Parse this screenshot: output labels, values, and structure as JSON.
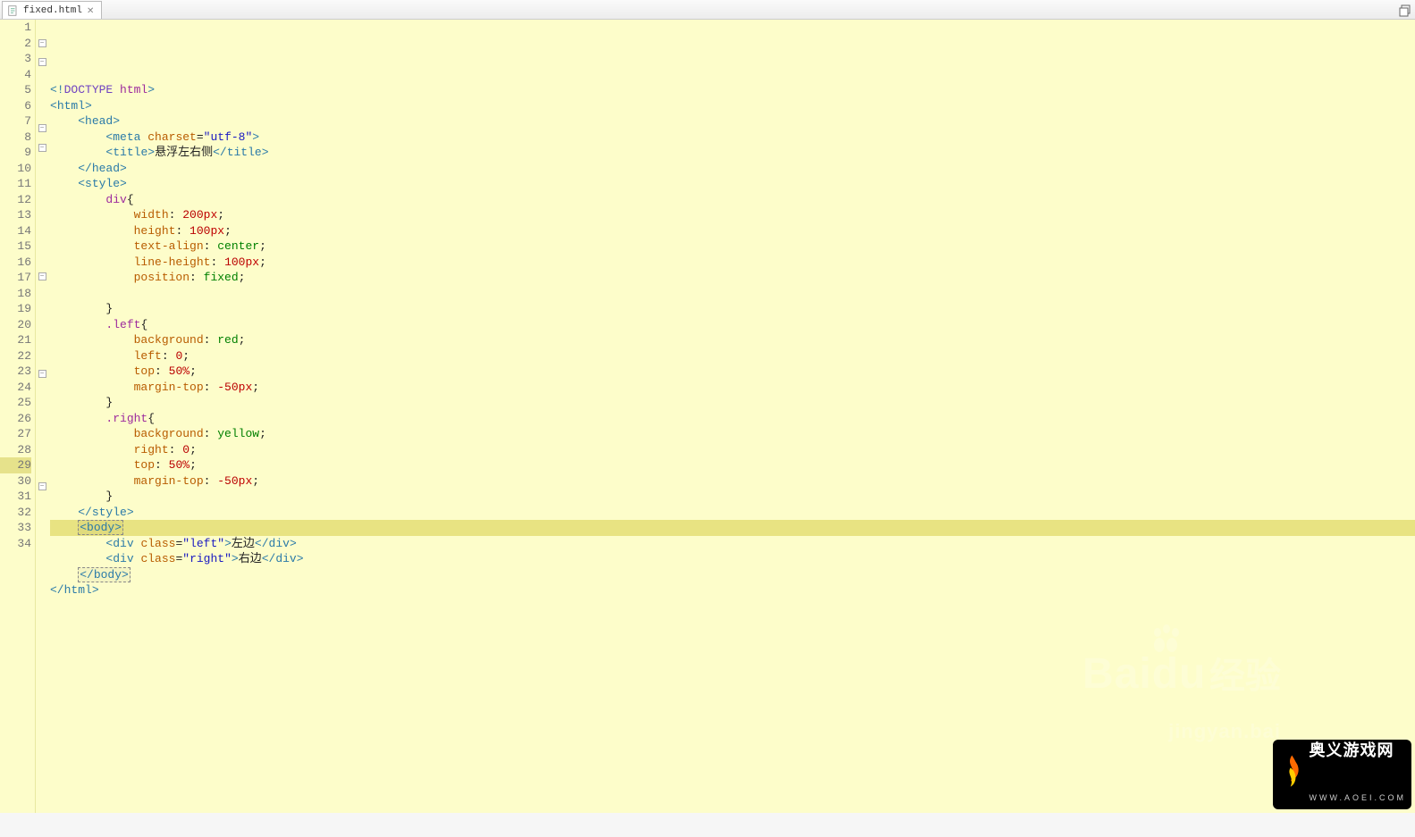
{
  "tab": {
    "filename": "fixed.html"
  },
  "gutter": {
    "lines": 34,
    "fold_lines": [
      2,
      3,
      7,
      8,
      16,
      22,
      29
    ]
  },
  "code_lines": [
    {
      "n": 1,
      "tokens": [
        [
          "<!",
          "tag"
        ],
        [
          "DOCTYPE ",
          "kw"
        ],
        [
          "html",
          "magenta"
        ],
        [
          ">",
          "tag"
        ]
      ]
    },
    {
      "n": 2,
      "fold": true,
      "tokens": [
        [
          "<",
          "tag"
        ],
        [
          "html",
          "tag"
        ],
        [
          ">",
          "tag"
        ]
      ]
    },
    {
      "n": 3,
      "fold": true,
      "tokens": [
        [
          "    ",
          "text"
        ],
        [
          "<",
          "tag"
        ],
        [
          "head",
          "tag"
        ],
        [
          ">",
          "tag"
        ]
      ]
    },
    {
      "n": 4,
      "tokens": [
        [
          "        ",
          "text"
        ],
        [
          "<",
          "tag"
        ],
        [
          "meta ",
          "tag"
        ],
        [
          "charset",
          "name"
        ],
        [
          "=",
          "text"
        ],
        [
          "\"utf-8\"",
          "str"
        ],
        [
          ">",
          "tag"
        ]
      ]
    },
    {
      "n": 5,
      "tokens": [
        [
          "        ",
          "text"
        ],
        [
          "<",
          "tag"
        ],
        [
          "title",
          "tag"
        ],
        [
          ">",
          "tag"
        ],
        [
          "悬浮左右侧",
          "text"
        ],
        [
          "</",
          "tag"
        ],
        [
          "title",
          "tag"
        ],
        [
          ">",
          "tag"
        ]
      ]
    },
    {
      "n": 6,
      "tokens": [
        [
          "    ",
          "text"
        ],
        [
          "</",
          "tag"
        ],
        [
          "head",
          "tag"
        ],
        [
          ">",
          "tag"
        ]
      ]
    },
    {
      "n": 7,
      "fold": true,
      "tokens": [
        [
          "    ",
          "text"
        ],
        [
          "<",
          "tag"
        ],
        [
          "style",
          "tag"
        ],
        [
          ">",
          "tag"
        ]
      ]
    },
    {
      "n": 8,
      "fold": true,
      "tokens": [
        [
          "        ",
          "text"
        ],
        [
          "div",
          "css-sel"
        ],
        [
          "{",
          "text"
        ]
      ]
    },
    {
      "n": 9,
      "tokens": [
        [
          "            ",
          "text"
        ],
        [
          "width",
          "cssprop"
        ],
        [
          ": ",
          "text"
        ],
        [
          "200",
          "cssnum"
        ],
        [
          "px",
          "red"
        ],
        [
          ";",
          "text"
        ]
      ]
    },
    {
      "n": 10,
      "tokens": [
        [
          "            ",
          "text"
        ],
        [
          "height",
          "cssprop"
        ],
        [
          ": ",
          "text"
        ],
        [
          "100",
          "cssnum"
        ],
        [
          "px",
          "red"
        ],
        [
          ";",
          "text"
        ]
      ]
    },
    {
      "n": 11,
      "tokens": [
        [
          "            ",
          "text"
        ],
        [
          "text-align",
          "cssprop"
        ],
        [
          ": ",
          "text"
        ],
        [
          "center",
          "cssval"
        ],
        [
          ";",
          "text"
        ]
      ]
    },
    {
      "n": 12,
      "tokens": [
        [
          "            ",
          "text"
        ],
        [
          "line-height",
          "cssprop"
        ],
        [
          ": ",
          "text"
        ],
        [
          "100",
          "cssnum"
        ],
        [
          "px",
          "red"
        ],
        [
          ";",
          "text"
        ]
      ]
    },
    {
      "n": 13,
      "tokens": [
        [
          "            ",
          "text"
        ],
        [
          "position",
          "cssprop"
        ],
        [
          ": ",
          "text"
        ],
        [
          "fixed",
          "cssval"
        ],
        [
          ";",
          "text"
        ]
      ]
    },
    {
      "n": 14,
      "tokens": [
        [
          "",
          "text"
        ]
      ]
    },
    {
      "n": 15,
      "tokens": [
        [
          "        ",
          "text"
        ],
        [
          "}",
          "text"
        ]
      ]
    },
    {
      "n": 16,
      "fold": true,
      "tokens": [
        [
          "        ",
          "text"
        ],
        [
          ".left",
          "css-sel"
        ],
        [
          "{",
          "text"
        ]
      ]
    },
    {
      "n": 17,
      "tokens": [
        [
          "            ",
          "text"
        ],
        [
          "background",
          "cssprop"
        ],
        [
          ": ",
          "text"
        ],
        [
          "red",
          "cssval"
        ],
        [
          ";",
          "text"
        ]
      ]
    },
    {
      "n": 18,
      "tokens": [
        [
          "            ",
          "text"
        ],
        [
          "left",
          "cssprop"
        ],
        [
          ": ",
          "text"
        ],
        [
          "0",
          "cssnum"
        ],
        [
          ";",
          "text"
        ]
      ]
    },
    {
      "n": 19,
      "tokens": [
        [
          "            ",
          "text"
        ],
        [
          "top",
          "cssprop"
        ],
        [
          ": ",
          "text"
        ],
        [
          "50",
          "cssnum"
        ],
        [
          "%",
          "red"
        ],
        [
          ";",
          "text"
        ]
      ]
    },
    {
      "n": 20,
      "tokens": [
        [
          "            ",
          "text"
        ],
        [
          "margin-top",
          "cssprop"
        ],
        [
          ": ",
          "text"
        ],
        [
          "-50",
          "cssnum"
        ],
        [
          "px",
          "red"
        ],
        [
          ";",
          "text"
        ]
      ]
    },
    {
      "n": 21,
      "tokens": [
        [
          "        ",
          "text"
        ],
        [
          "}",
          "text"
        ]
      ]
    },
    {
      "n": 22,
      "fold": true,
      "tokens": [
        [
          "        ",
          "text"
        ],
        [
          ".right",
          "css-sel"
        ],
        [
          "{",
          "text"
        ]
      ]
    },
    {
      "n": 23,
      "tokens": [
        [
          "            ",
          "text"
        ],
        [
          "background",
          "cssprop"
        ],
        [
          ": ",
          "text"
        ],
        [
          "yellow",
          "cssval"
        ],
        [
          ";",
          "text"
        ]
      ]
    },
    {
      "n": 24,
      "tokens": [
        [
          "            ",
          "text"
        ],
        [
          "right",
          "cssprop"
        ],
        [
          ": ",
          "text"
        ],
        [
          "0",
          "cssnum"
        ],
        [
          ";",
          "text"
        ]
      ]
    },
    {
      "n": 25,
      "tokens": [
        [
          "            ",
          "text"
        ],
        [
          "top",
          "cssprop"
        ],
        [
          ": ",
          "text"
        ],
        [
          "50",
          "cssnum"
        ],
        [
          "%",
          "red"
        ],
        [
          ";",
          "text"
        ]
      ]
    },
    {
      "n": 26,
      "tokens": [
        [
          "            ",
          "text"
        ],
        [
          "margin-top",
          "cssprop"
        ],
        [
          ": ",
          "text"
        ],
        [
          "-50",
          "cssnum"
        ],
        [
          "px",
          "red"
        ],
        [
          ";",
          "text"
        ]
      ]
    },
    {
      "n": 27,
      "tokens": [
        [
          "        ",
          "text"
        ],
        [
          "}",
          "text"
        ]
      ]
    },
    {
      "n": 28,
      "tokens": [
        [
          "    ",
          "text"
        ],
        [
          "</",
          "tag"
        ],
        [
          "style",
          "tag"
        ],
        [
          ">",
          "tag"
        ]
      ]
    },
    {
      "n": 29,
      "fold": true,
      "highlight": true,
      "tokens": [
        [
          "    ",
          "text"
        ],
        [
          "<body>",
          "boxtag"
        ]
      ]
    },
    {
      "n": 30,
      "tokens": [
        [
          "        ",
          "text"
        ],
        [
          "<",
          "tag"
        ],
        [
          "div ",
          "tag"
        ],
        [
          "class",
          "name"
        ],
        [
          "=",
          "text"
        ],
        [
          "\"left\"",
          "str"
        ],
        [
          ">",
          "tag"
        ],
        [
          "左边",
          "text"
        ],
        [
          "</",
          "tag"
        ],
        [
          "div",
          "tag"
        ],
        [
          ">",
          "tag"
        ]
      ]
    },
    {
      "n": 31,
      "tokens": [
        [
          "        ",
          "text"
        ],
        [
          "<",
          "tag"
        ],
        [
          "div ",
          "tag"
        ],
        [
          "class",
          "name"
        ],
        [
          "=",
          "text"
        ],
        [
          "\"right\"",
          "str"
        ],
        [
          ">",
          "tag"
        ],
        [
          "右边",
          "text"
        ],
        [
          "</",
          "tag"
        ],
        [
          "div",
          "tag"
        ],
        [
          ">",
          "tag"
        ]
      ]
    },
    {
      "n": 32,
      "tokens": [
        [
          "    ",
          "text"
        ],
        [
          "</body>",
          "boxtag"
        ]
      ]
    },
    {
      "n": 33,
      "tokens": [
        [
          "</",
          "tag"
        ],
        [
          "html",
          "tag"
        ],
        [
          ">",
          "tag"
        ]
      ]
    },
    {
      "n": 34,
      "tokens": [
        [
          "",
          "text"
        ]
      ]
    }
  ],
  "watermark": {
    "baidu_big": "Bai",
    "baidu_du": "du",
    "baidu_cn": "经验",
    "baidu_sub": "jingyan.bai"
  },
  "logo": {
    "cn": "奥义游戏网",
    "en": "WWW.AOEI.COM"
  }
}
